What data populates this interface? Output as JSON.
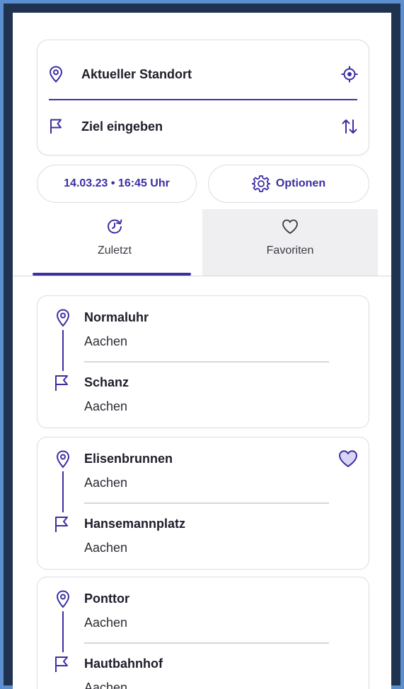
{
  "search": {
    "origin_label": "Aktueller Standort",
    "destination_label": "Ziel eingeben"
  },
  "trip_options": {
    "datetime_label": "14.03.23 • 16:45 Uhr",
    "options_label": "Optionen"
  },
  "tabs": [
    {
      "label": "Zuletzt",
      "icon": "history-icon",
      "active": true
    },
    {
      "label": "Favoriten",
      "icon": "heart-icon",
      "active": false
    }
  ],
  "recent_trips": [
    {
      "from": {
        "name": "Normaluhr",
        "city": "Aachen"
      },
      "to": {
        "name": "Schanz",
        "city": "Aachen"
      },
      "favorite": false
    },
    {
      "from": {
        "name": "Elisenbrunnen",
        "city": "Aachen"
      },
      "to": {
        "name": "Hansemannplatz",
        "city": "Aachen"
      },
      "favorite": true
    },
    {
      "from": {
        "name": "Ponttor",
        "city": "Aachen"
      },
      "to": {
        "name": "Hautbahnhof",
        "city": "Aachen"
      },
      "favorite": false
    }
  ],
  "colors": {
    "accent": "#3b2fa3",
    "favorite_fill": "#d9d4f5",
    "frame_outer": "#5b8fcf",
    "frame_inner": "#1f3350",
    "inactive_tab_bg": "#efeff1"
  }
}
